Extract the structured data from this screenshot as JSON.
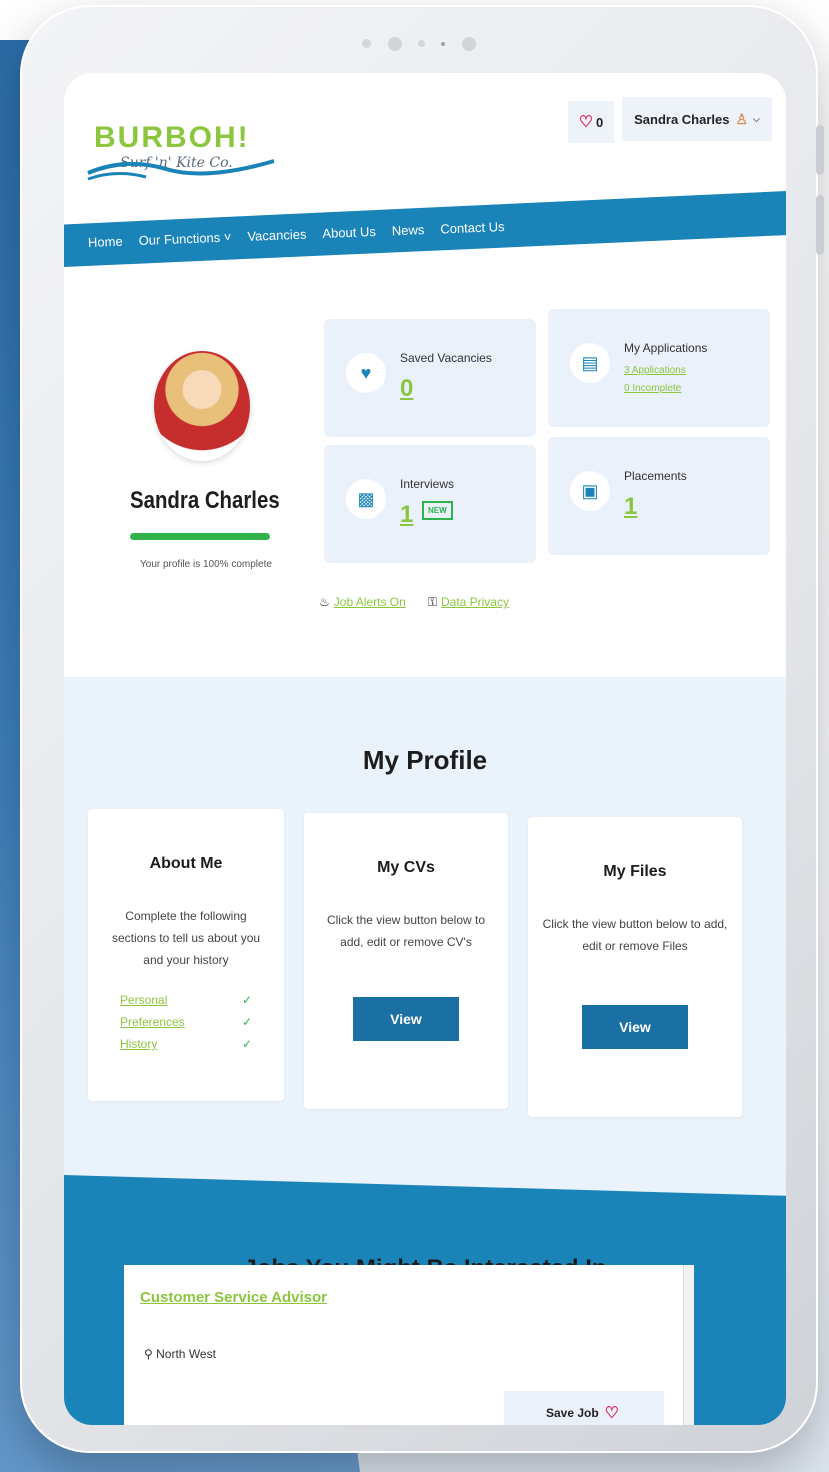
{
  "brand": {
    "name": "BURBOH!",
    "tagline": "Surf 'n' Kite Co.",
    "accent": "#8cc63f",
    "primary": "#1a84b8"
  },
  "header": {
    "favourites_count": "0",
    "user_name": "Sandra Charles"
  },
  "nav": {
    "items": [
      {
        "label": "Home"
      },
      {
        "label": "Our Functions ˅"
      },
      {
        "label": "Vacancies"
      },
      {
        "label": "About Us"
      },
      {
        "label": "News"
      },
      {
        "label": "Contact Us"
      }
    ]
  },
  "profile": {
    "name": "Sandra Charles",
    "completion_percent": 100,
    "completion_text": "Your profile is 100% complete"
  },
  "stats": {
    "saved": {
      "title": "Saved Vacancies",
      "value": "0"
    },
    "applications": {
      "title": "My Applications",
      "line1": "3 Applications",
      "line2": "0 Incomplete"
    },
    "interviews": {
      "title": "Interviews",
      "value": "1",
      "badge": "NEW"
    },
    "placements": {
      "title": "Placements",
      "value": "1"
    }
  },
  "links": {
    "job_alerts": "Job Alerts On",
    "data_privacy": "Data Privacy"
  },
  "my_profile": {
    "title": "My Profile",
    "about": {
      "title": "About Me",
      "text": "Complete the following sections to tell us about you and your history",
      "rows": [
        {
          "label": "Personal",
          "check": "✓"
        },
        {
          "label": "Preferences",
          "check": "✓"
        },
        {
          "label": "History",
          "check": "✓"
        }
      ]
    },
    "cvs": {
      "title": "My CVs",
      "text": "Click the view button below to add, edit or remove CV's",
      "button": "View"
    },
    "files": {
      "title": "My Files",
      "text": "Click the view button below to add, edit or remove Files",
      "button": "View"
    }
  },
  "jobs": {
    "title": "Jobs You Might Be Interested In",
    "first": {
      "title": "Customer Service Advisor",
      "location": "North West",
      "save_label": "Save Job"
    }
  },
  "icons": {
    "heart": "heart-icon",
    "user": "user-icon",
    "saved": "heart-icon",
    "applications": "clipboard-icon",
    "interviews": "chair-icon",
    "placements": "briefcase-icon",
    "alerts": "bell-icon",
    "privacy": "lock-icon",
    "location": "map-pin-icon"
  }
}
